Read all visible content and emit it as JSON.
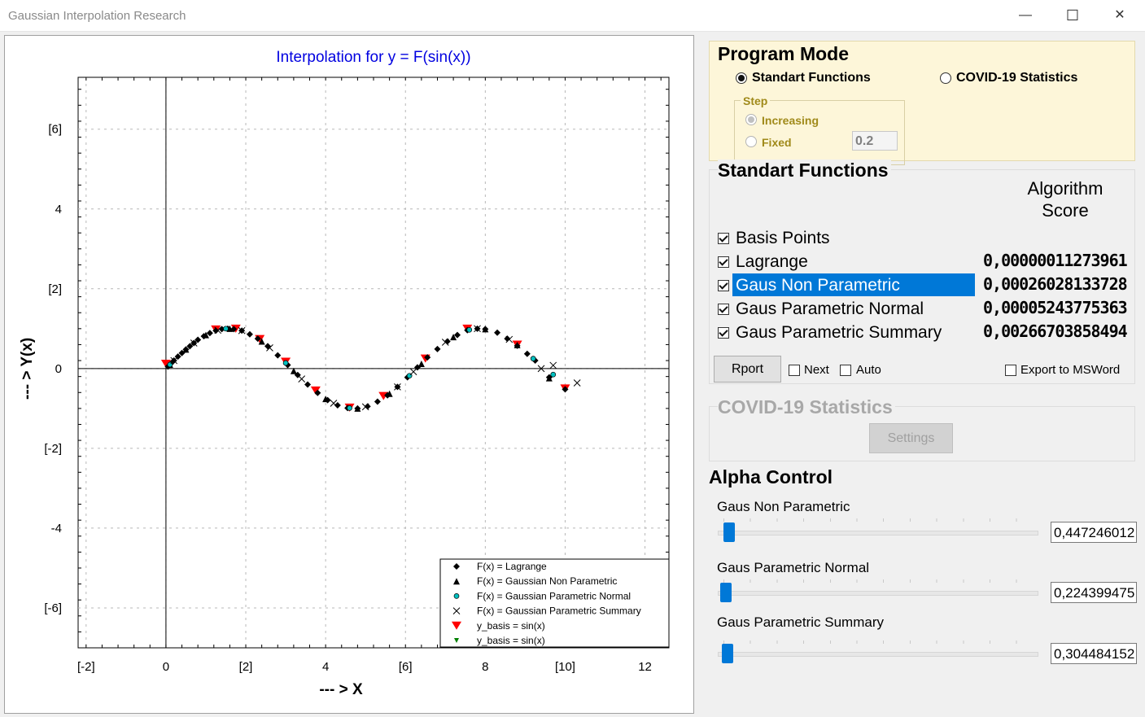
{
  "window": {
    "title": "Gaussian Interpolation Research",
    "minimize": "—",
    "maximize": "☐",
    "close": "✕"
  },
  "chart_data": {
    "type": "scatter",
    "title": "Interpolation for y = F(sin(x))",
    "xlabel": "--- > X",
    "ylabel": "--- > Y(x)",
    "xlim": [
      -2.2,
      12.6
    ],
    "ylim": [
      -7.0,
      7.3
    ],
    "x_ticks": [
      {
        "v": -2,
        "label": "[-2]"
      },
      {
        "v": 0,
        "label": "0"
      },
      {
        "v": 2,
        "label": "[2]"
      },
      {
        "v": 4,
        "label": "4"
      },
      {
        "v": 6,
        "label": "[6]"
      },
      {
        "v": 8,
        "label": "8"
      },
      {
        "v": 10,
        "label": "[10]"
      },
      {
        "v": 12,
        "label": "12"
      }
    ],
    "y_ticks": [
      {
        "v": 6,
        "label": "[6]"
      },
      {
        "v": 4,
        "label": "4"
      },
      {
        "v": 2,
        "label": "[2]"
      },
      {
        "v": 0,
        "label": "0"
      },
      {
        "v": -2,
        "label": "[-2]"
      },
      {
        "v": -4,
        "label": "-4"
      },
      {
        "v": -6,
        "label": "[-6]"
      }
    ],
    "grid": true,
    "legend_position": "bottom-right",
    "series": [
      {
        "name": "F(x) = Lagrange",
        "marker": "diamond",
        "color": "#000000",
        "x": [
          0.05,
          0.12,
          0.2,
          0.3,
          0.4,
          0.5,
          0.6,
          0.7,
          0.8,
          0.95,
          1.1,
          1.25,
          1.4,
          1.55,
          1.7,
          1.9,
          2.1,
          2.3,
          2.55,
          2.8,
          3.05,
          3.3,
          3.55,
          3.8,
          4.05,
          4.3,
          4.55,
          4.8,
          5.05,
          5.3,
          5.55,
          5.8,
          6.05,
          6.3,
          6.55,
          6.8,
          7.05,
          7.3,
          7.55,
          7.8,
          8.0,
          8.3,
          8.55,
          8.8,
          9.05,
          9.25,
          9.6,
          10.0
        ],
        "y": [
          0.05,
          0.12,
          0.2,
          0.3,
          0.39,
          0.48,
          0.56,
          0.64,
          0.72,
          0.81,
          0.89,
          0.95,
          0.99,
          1.0,
          0.99,
          0.95,
          0.86,
          0.75,
          0.56,
          0.33,
          0.09,
          -0.16,
          -0.4,
          -0.61,
          -0.79,
          -0.92,
          -0.99,
          -1.0,
          -0.95,
          -0.83,
          -0.67,
          -0.46,
          -0.22,
          0.03,
          0.28,
          0.49,
          0.68,
          0.84,
          0.96,
          1.0,
          0.99,
          0.9,
          0.75,
          0.57,
          0.37,
          0.2,
          -0.22,
          -0.52
        ]
      },
      {
        "name": "F(x) = Gaussian Non Parametric",
        "marker": "triangle",
        "color": "#000000",
        "x": [
          0.1,
          0.5,
          1.0,
          1.6,
          2.4,
          3.2,
          4.0,
          4.8,
          5.6,
          6.4,
          7.2,
          8.0,
          8.8,
          9.6
        ],
        "y": [
          0.1,
          0.48,
          0.84,
          1.0,
          0.68,
          -0.06,
          -0.76,
          -1.0,
          -0.63,
          0.12,
          0.79,
          0.99,
          0.59,
          -0.24
        ]
      },
      {
        "name": "F(x) = Gaussian Parametric Normal",
        "marker": "circle",
        "color": "#00c0c0",
        "x": [
          0.1,
          1.5,
          3.0,
          4.6,
          6.1,
          7.6,
          9.2,
          9.7
        ],
        "y": [
          0.1,
          1.0,
          0.14,
          -0.99,
          -0.18,
          0.97,
          0.25,
          -0.15
        ]
      },
      {
        "name": "F(x) = Gaussian Parametric Summary",
        "marker": "x",
        "color": "#000000",
        "x": [
          0.2,
          0.7,
          1.3,
          1.9,
          2.6,
          3.4,
          4.2,
          5.0,
          5.8,
          6.2,
          7.0,
          7.8,
          8.6,
          9.4,
          9.7,
          10.3
        ],
        "y": [
          0.2,
          0.64,
          0.96,
          0.95,
          0.52,
          -0.26,
          -0.87,
          -0.96,
          -0.46,
          -0.08,
          0.66,
          1.0,
          0.73,
          0.0,
          0.08,
          -0.36
        ]
      },
      {
        "name": "y_basis = sin(x)",
        "marker": "triangle-down",
        "color": "#ff0000",
        "x": [
          0.0,
          1.25,
          1.75,
          2.35,
          3.0,
          3.75,
          4.6,
          5.45,
          6.5,
          7.55,
          8.8,
          10.0
        ],
        "y": [
          0.12,
          0.98,
          1.0,
          0.74,
          0.17,
          -0.55,
          -0.98,
          -0.69,
          0.25,
          1.0,
          0.6,
          -0.5
        ]
      },
      {
        "name": "y_basis = sin(x)",
        "marker": "triangle-down-small",
        "color": "#008000",
        "x": [],
        "y": []
      }
    ]
  },
  "program_mode": {
    "heading": "Program Mode",
    "standart_label": "Standart Functions",
    "covid_label": "COVID-19 Statistics",
    "step": {
      "title": "Step",
      "increasing": "Increasing",
      "fixed": "Fixed",
      "value": "0.2"
    }
  },
  "functions": {
    "heading": "Standart Functions",
    "score_header": "Algorithm\nScore",
    "items": [
      {
        "label": "Basis Points",
        "score": ""
      },
      {
        "label": "Lagrange",
        "score": "0,00000011273961"
      },
      {
        "label": "Gaus Non Parametric",
        "score": "0,00026028133728"
      },
      {
        "label": "Gaus Parametric Normal",
        "score": "0,00005243775363"
      },
      {
        "label": "Gaus Parametric Summary",
        "score": "0,00266703858494"
      }
    ],
    "report_button": "Rport",
    "next_label": "Next",
    "auto_label": "Auto",
    "export_label": "Export to MSWord"
  },
  "covid": {
    "heading": "COVID-19 Statistics",
    "settings_button": "Settings"
  },
  "alpha": {
    "heading": "Alpha Control",
    "sliders": [
      {
        "label": "Gaus Non Parametric",
        "value": "0,447246012",
        "level": 0.02
      },
      {
        "label": "Gaus Parametric Normal",
        "value": "0,224399475",
        "level": 0.0
      },
      {
        "label": "Gaus Parametric Summary",
        "value": "0,304484152",
        "level": 0.01
      }
    ]
  }
}
